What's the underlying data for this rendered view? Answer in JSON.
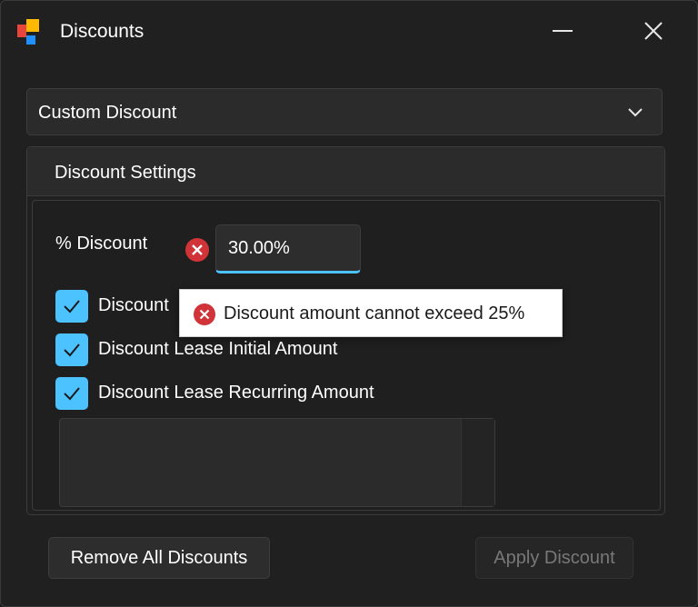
{
  "window": {
    "title": "Discounts",
    "minimize_icon": "minimize-icon",
    "close_icon": "close-icon",
    "app_icon_colors": [
      "#e8453c",
      "#ffb900",
      "#1e90ff"
    ]
  },
  "discount_type": {
    "selected": "Custom Discount",
    "icon": "chevron-down-icon"
  },
  "settings": {
    "title": "Discount Settings",
    "percent_label": "% Discount",
    "percent_value": "30.00%",
    "error_icon": "error-icon",
    "options": [
      {
        "label": "Discount",
        "checked": true
      },
      {
        "label": "Discount Lease Initial Amount",
        "checked": true
      },
      {
        "label": "Discount Lease Recurring Amount",
        "checked": true
      }
    ]
  },
  "tooltip": {
    "message": "Discount amount cannot exceed 25%",
    "icon": "error-icon"
  },
  "footer": {
    "remove_label": "Remove All Discounts",
    "apply_label": "Apply Discount",
    "apply_enabled": false
  },
  "colors": {
    "accent": "#4cc2ff",
    "error": "#d13438",
    "background": "#202020"
  }
}
